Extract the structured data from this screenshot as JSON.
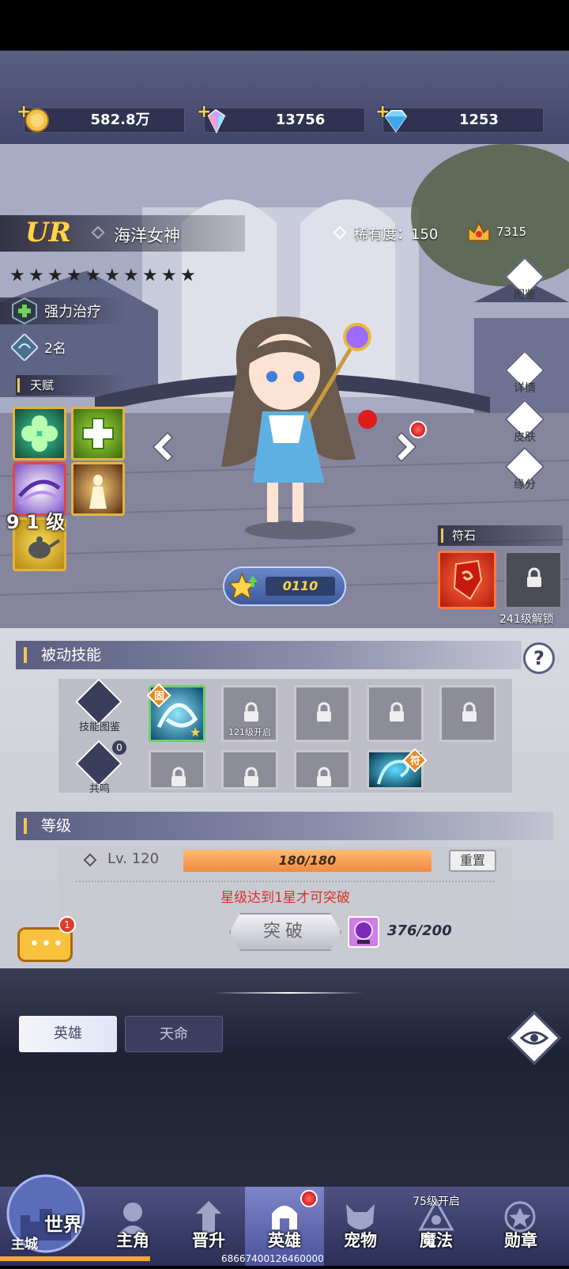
{
  "currencies": [
    {
      "name": "gold",
      "value": "582.8万"
    },
    {
      "name": "rainbow-gem",
      "value": "13756"
    },
    {
      "name": "diamond",
      "value": "1253"
    }
  ],
  "hero": {
    "rank": "UR",
    "name": "海洋女神",
    "rarity_label": "稀有度：150",
    "power": "7315",
    "stars": 10,
    "role": "强力治疗",
    "rank_num": "2名",
    "talent_label": "天赋",
    "level_badge": "9 1 级",
    "exp_value": "0110"
  },
  "side_buttons": [
    {
      "label": "图鉴"
    },
    {
      "label": "详情"
    },
    {
      "label": "皮肤"
    },
    {
      "label": "缘分"
    }
  ],
  "rune": {
    "label": "符石",
    "unlock": "241级解锁"
  },
  "passive": {
    "title": "被动技能",
    "lib_label": "技能图鉴",
    "resonance_label": "共鸣",
    "resonance_count": "0",
    "slot_lock_text": "121级开启",
    "fixed_badge": "固",
    "rune_badge": "符"
  },
  "level": {
    "title": "等级",
    "lv": "Lv. 120",
    "exp": "180/180",
    "reset": "重置",
    "hint": "星级达到1星才可突破",
    "breakthrough": "突破",
    "cost": "376/200"
  },
  "chat_badge": "1",
  "tabs": {
    "hero": "英雄",
    "fate": "天命"
  },
  "nav": {
    "world": "世界",
    "city": "主城",
    "items": [
      "主角",
      "晋升",
      "英雄",
      "宠物",
      "魔法",
      "勋章"
    ],
    "magic_unlock": "75级开启"
  },
  "footer_id": "68667400126460000",
  "colors": {
    "accent": "#f0c857",
    "exp_bar": "#f5a35a",
    "hint_red": "#d8322b"
  }
}
